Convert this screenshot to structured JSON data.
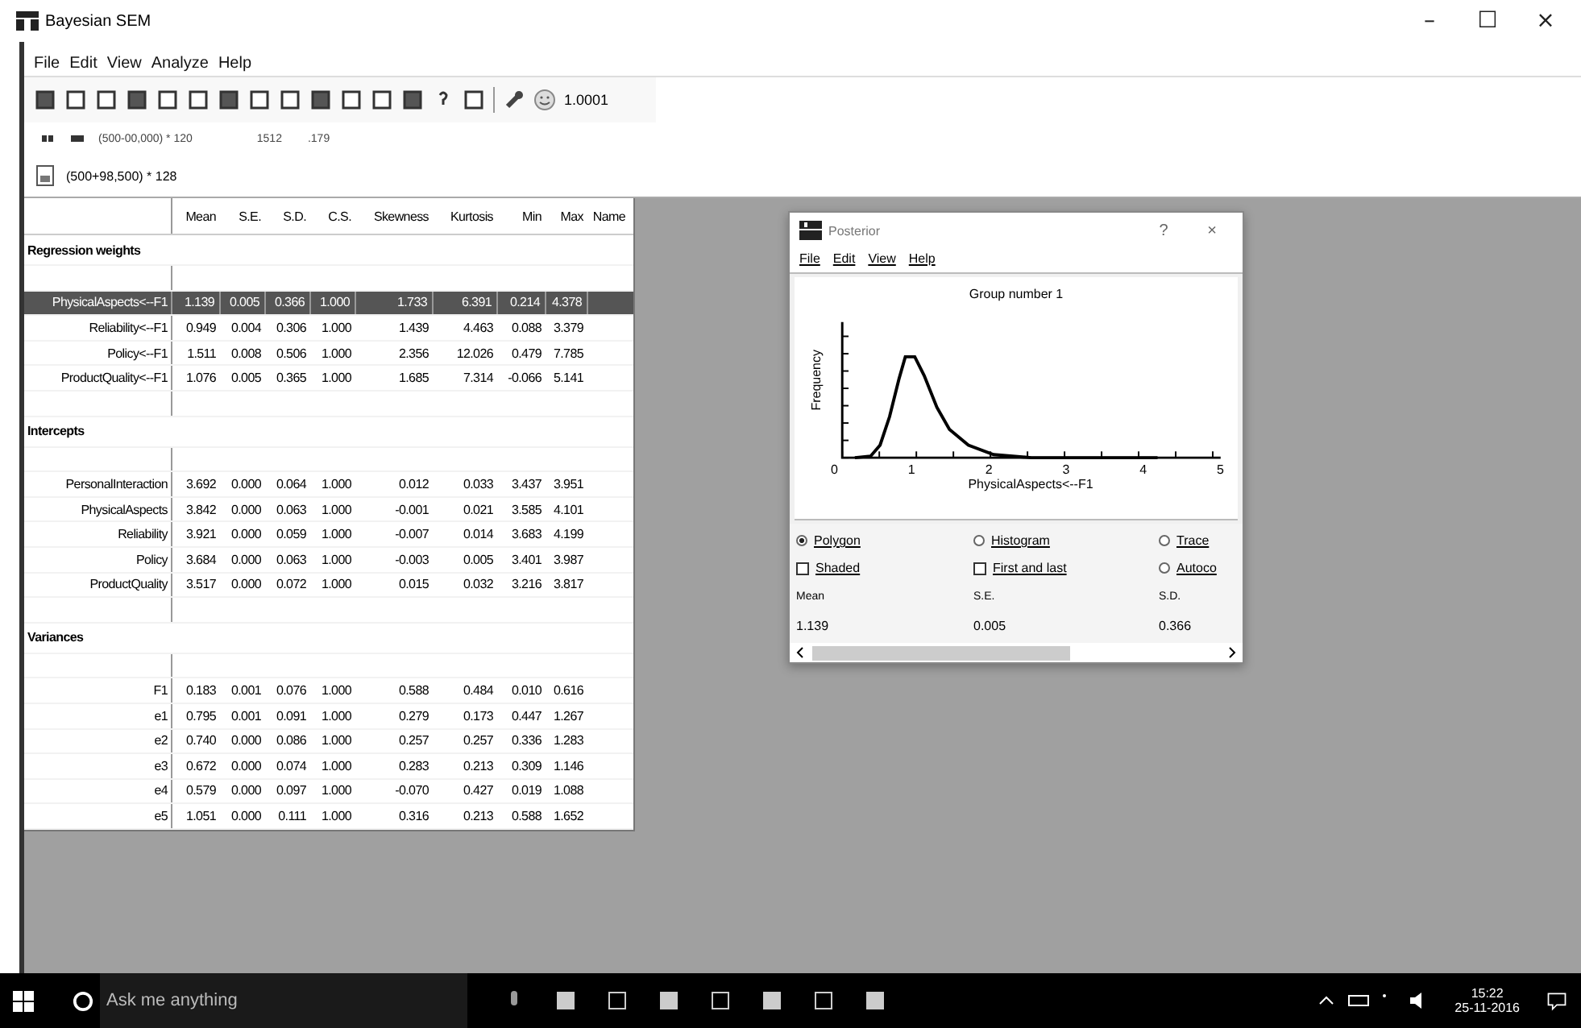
{
  "window": {
    "title": "Bayesian SEM",
    "controls": [
      "–",
      "☐",
      "×"
    ]
  },
  "menu": [
    "File",
    "Edit",
    "View",
    "Analyze",
    "Help"
  ],
  "toolbar": {
    "value": "1.0001"
  },
  "status_row": {
    "formula": "(500-00,000) * 120",
    "count": "1512",
    "ratio": ".179"
  },
  "sample_row": {
    "formula": "(500+98,500) * 128"
  },
  "table": {
    "columns": [
      "Mean",
      "S.E.",
      "S.D.",
      "C.S.",
      "Skewness",
      "Kurtosis",
      "Min",
      "Max",
      "Name"
    ],
    "sections": [
      {
        "title": "Regression weights",
        "rows": [
          {
            "label": "PhysicalAspects<--F1",
            "values": [
              "1.139",
              "0.005",
              "0.366",
              "1.000",
              "1.733",
              "6.391",
              "0.214",
              "4.378"
            ],
            "selected": true
          },
          {
            "label": "Reliability<--F1",
            "values": [
              "0.949",
              "0.004",
              "0.306",
              "1.000",
              "1.439",
              "4.463",
              "0.088",
              "3.379"
            ],
            "selected": false
          },
          {
            "label": "Policy<--F1",
            "values": [
              "1.511",
              "0.008",
              "0.506",
              "1.000",
              "2.356",
              "12.026",
              "0.479",
              "7.785"
            ],
            "selected": false
          },
          {
            "label": "ProductQuality<--F1",
            "values": [
              "1.076",
              "0.005",
              "0.365",
              "1.000",
              "1.685",
              "7.314",
              "-0.066",
              "5.141"
            ],
            "selected": false
          }
        ]
      },
      {
        "title": "Intercepts",
        "rows": [
          {
            "label": "PersonalInteraction",
            "values": [
              "3.692",
              "0.000",
              "0.064",
              "1.000",
              "0.012",
              "0.033",
              "3.437",
              "3.951"
            ],
            "selected": false
          },
          {
            "label": "PhysicalAspects",
            "values": [
              "3.842",
              "0.000",
              "0.063",
              "1.000",
              "-0.001",
              "0.021",
              "3.585",
              "4.101"
            ],
            "selected": false
          },
          {
            "label": "Reliability",
            "values": [
              "3.921",
              "0.000",
              "0.059",
              "1.000",
              "-0.007",
              "0.014",
              "3.683",
              "4.199"
            ],
            "selected": false
          },
          {
            "label": "Policy",
            "values": [
              "3.684",
              "0.000",
              "0.063",
              "1.000",
              "-0.003",
              "0.005",
              "3.401",
              "3.987"
            ],
            "selected": false
          },
          {
            "label": "ProductQuality",
            "values": [
              "3.517",
              "0.000",
              "0.072",
              "1.000",
              "0.015",
              "0.032",
              "3.216",
              "3.817"
            ],
            "selected": false
          }
        ]
      },
      {
        "title": "Variances",
        "rows": [
          {
            "label": "F1",
            "values": [
              "0.183",
              "0.001",
              "0.076",
              "1.000",
              "0.588",
              "0.484",
              "0.010",
              "0.616"
            ],
            "selected": false
          },
          {
            "label": "e1",
            "values": [
              "0.795",
              "0.001",
              "0.091",
              "1.000",
              "0.279",
              "0.173",
              "0.447",
              "1.267"
            ],
            "selected": false
          },
          {
            "label": "e2",
            "values": [
              "0.740",
              "0.000",
              "0.086",
              "1.000",
              "0.257",
              "0.257",
              "0.336",
              "1.283"
            ],
            "selected": false
          },
          {
            "label": "e3",
            "values": [
              "0.672",
              "0.000",
              "0.074",
              "1.000",
              "0.283",
              "0.213",
              "0.309",
              "1.146"
            ],
            "selected": false
          },
          {
            "label": "e4",
            "values": [
              "0.579",
              "0.000",
              "0.097",
              "1.000",
              "-0.070",
              "0.427",
              "0.019",
              "1.088"
            ],
            "selected": false
          },
          {
            "label": "e5",
            "values": [
              "1.051",
              "0.000",
              "0.111",
              "1.000",
              "0.316",
              "0.213",
              "0.588",
              "1.652"
            ],
            "selected": false
          }
        ]
      }
    ]
  },
  "posterior": {
    "title": "Posterior",
    "controls": [
      "?",
      "×"
    ],
    "menu": [
      "File",
      "Edit",
      "View",
      "Help"
    ],
    "plot": {
      "title": "Group number 1",
      "ylabel": "Frequency",
      "xlabel": "PhysicalAspects<--F1",
      "xticks": [
        "0",
        "1",
        "2",
        "3",
        "4",
        "5"
      ]
    },
    "options": [
      {
        "kind": "radio",
        "label": "Polygon",
        "selected": true
      },
      {
        "kind": "radio",
        "label": "Histogram",
        "selected": false
      },
      {
        "kind": "radio",
        "label": "Trace",
        "selected": false
      },
      {
        "kind": "checkbox",
        "label": "Shaded",
        "checked": false
      },
      {
        "kind": "checkbox",
        "label": "First and last",
        "checked": false
      },
      {
        "kind": "radio",
        "label": "Autoco",
        "selected": false
      }
    ],
    "stats": [
      {
        "name": "Mean",
        "value": "1.139"
      },
      {
        "name": "S.E.",
        "value": "0.005"
      },
      {
        "name": "S.D.",
        "value": "0.366"
      }
    ]
  },
  "taskbar": {
    "search": {
      "placeholder": "Ask me anything"
    },
    "time": "15:22",
    "date": "25-11-2016"
  }
}
